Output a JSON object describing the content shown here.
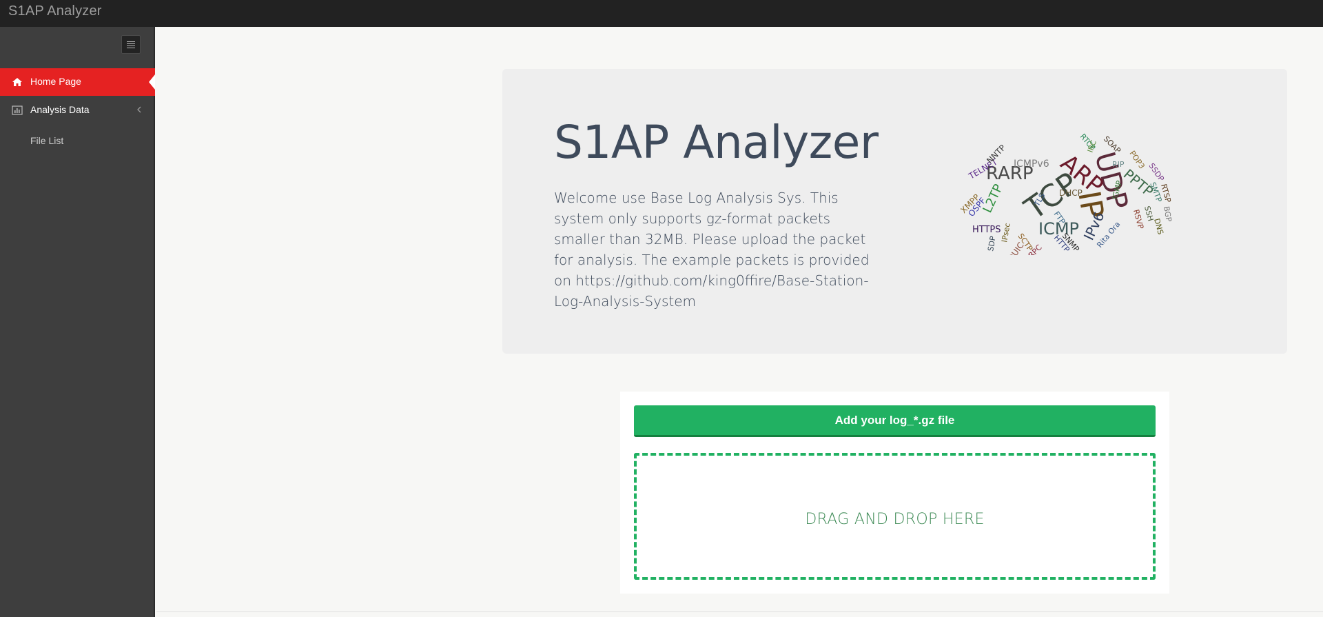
{
  "app": {
    "brand": "S1AP Analyzer"
  },
  "sidebar": {
    "toggle_icon": "hamburger-icon",
    "items": [
      {
        "label": "Home Page",
        "icon": "home-icon",
        "active": true,
        "active_color": "#e52222"
      },
      {
        "label": "Analysis Data",
        "icon": "bar-chart-icon",
        "chevron": "chevron-left-icon"
      }
    ],
    "subitems": [
      {
        "label": "File List"
      }
    ]
  },
  "hero": {
    "title": "S1AP Analyzer",
    "text": "Welcome use Base Log Analysis Sys. This system only supports gz-format packets smaller than 32MB. Please upload the packet for analysis. The example packets is provided on https://github.com/king0ffire/Base-Station-Log-Analysis-System",
    "word_cloud": {
      "words": [
        "TCP",
        "UDP",
        "ARP",
        "IP",
        "RARP",
        "ICMP",
        "IPv6",
        "PPTP",
        "L2TP",
        "ICMPv6",
        "TELNET",
        "NNTP",
        "XMPP",
        "OSPF",
        "HTTPS",
        "SDP",
        "IPsec",
        "QUIC",
        "SCTP",
        "RPC",
        "HTTP",
        "SNMP",
        "FTP",
        "TLS",
        "DHCP",
        "RTCP",
        "IRC",
        "SOAP",
        "RIP",
        "POP3",
        "SSDP",
        "SMTP",
        "RTSP",
        "BGP",
        "SSH",
        "DNS",
        "RSVP",
        "IGMP",
        "Rita Ora"
      ]
    }
  },
  "upload": {
    "button_label": "Add your log_*.gz file",
    "drop_text": "DRAG AND DROP HERE",
    "accent_color": "#21b162"
  }
}
